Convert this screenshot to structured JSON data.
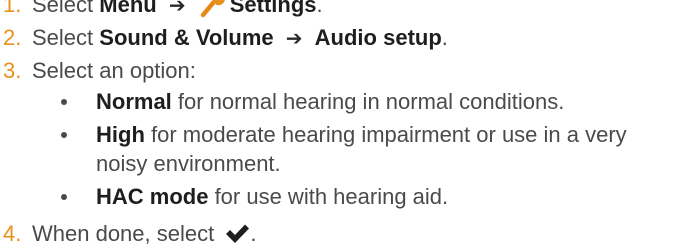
{
  "steps": [
    {
      "num": "1.",
      "pre": "Select",
      "b1": "Menu",
      "b2": "Settings",
      "post": "."
    },
    {
      "num": "2.",
      "pre": "Select",
      "b1": "Sound & Volume",
      "b2": "Audio setup",
      "post": "."
    },
    {
      "num": "3.",
      "text": "Select an option:"
    },
    {
      "num": "4.",
      "pre": "When done, select",
      "post": "."
    }
  ],
  "options": [
    {
      "term": "Normal",
      "desc": " for normal hearing in normal conditions."
    },
    {
      "term": "High",
      "desc_line1": " for moderate hearing impairment or use in a very",
      "desc_line2": "noisy environment."
    },
    {
      "term": "HAC mode",
      "desc": " for use with hearing aid."
    }
  ],
  "icons": {
    "arrow": "right-arrow-icon",
    "wrench": "wrench-icon",
    "check": "checkmark-icon",
    "wrench_color": "#e8911a",
    "check_color": "#1e1e1e"
  },
  "colors": {
    "number": "#e8911a",
    "text": "#4a4a4a",
    "bold": "#1e1e1e"
  }
}
